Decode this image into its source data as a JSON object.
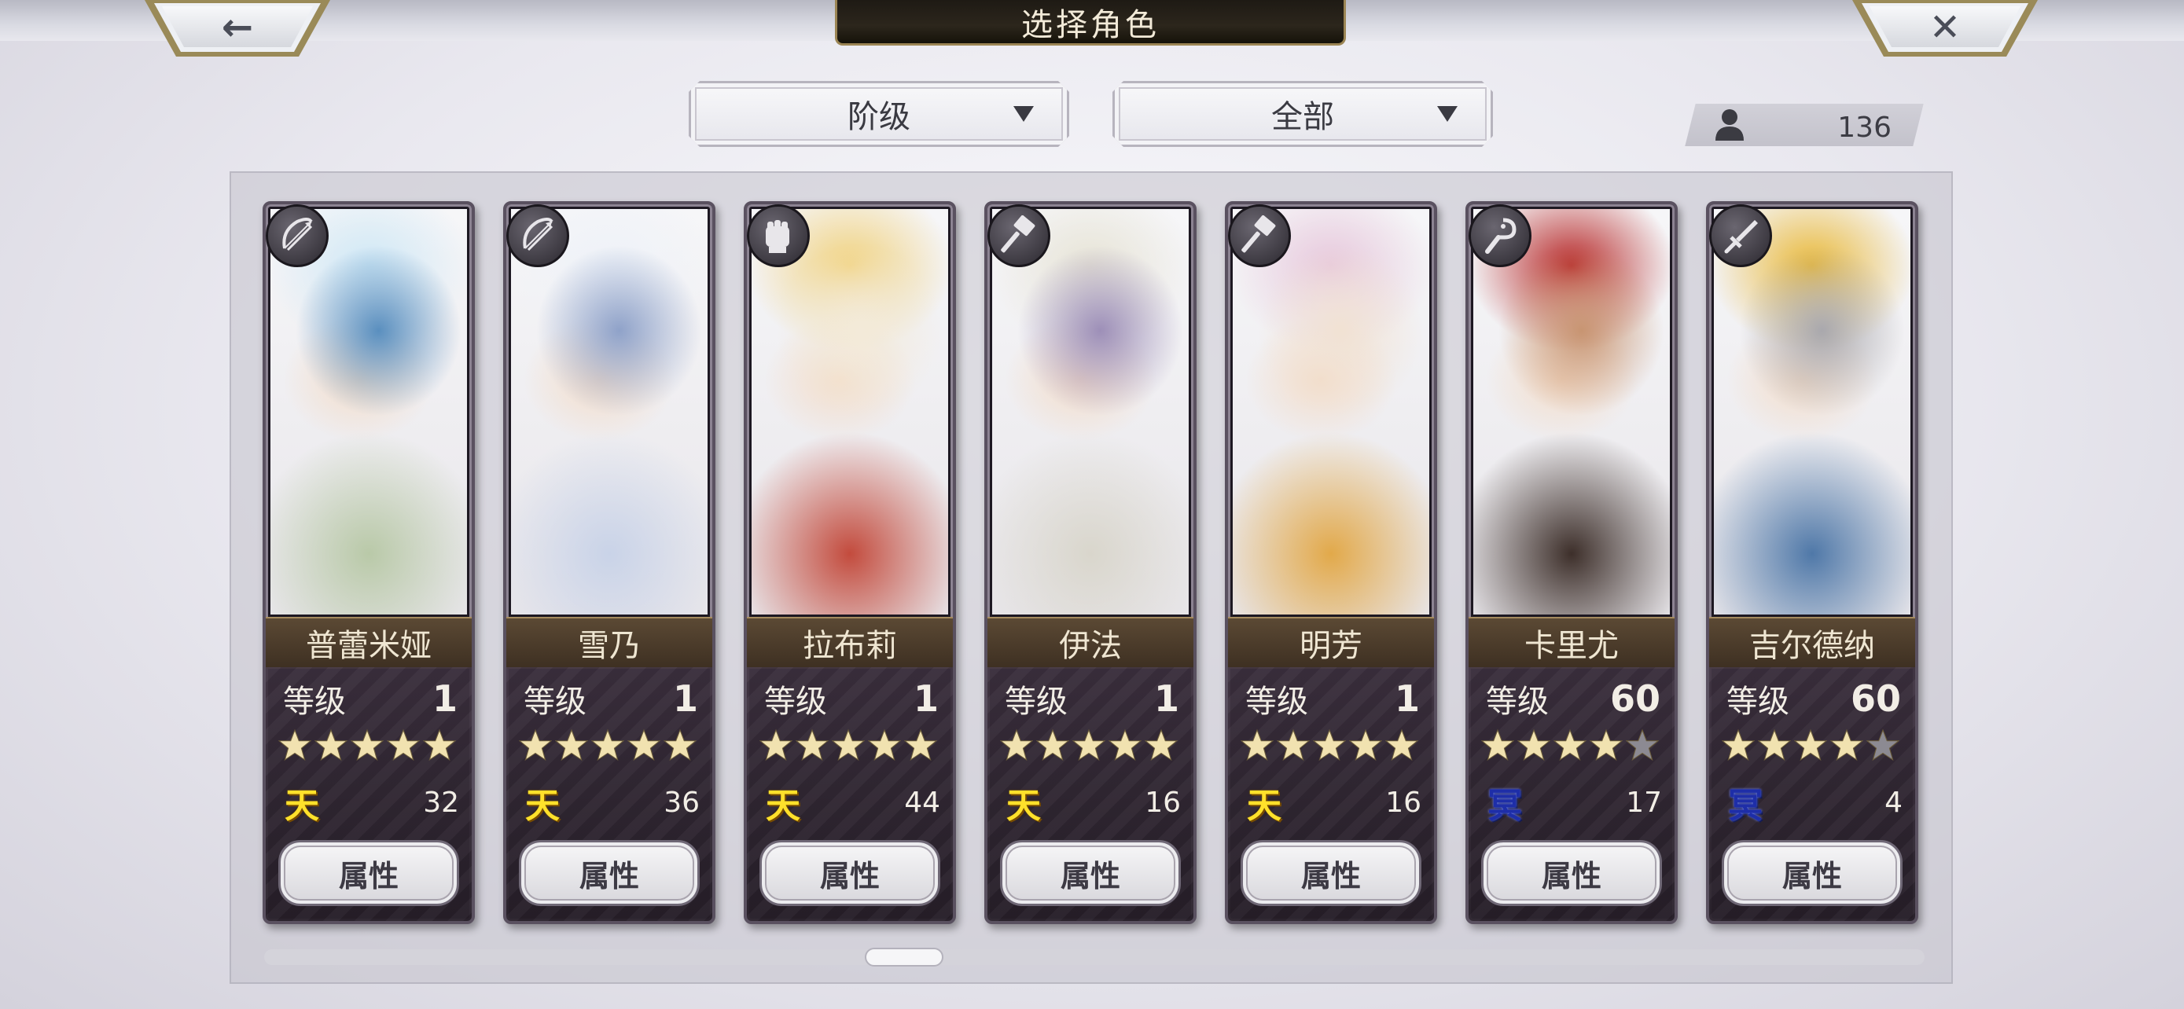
{
  "header": {
    "title": "选择角色",
    "back_icon": "left-arrow-icon",
    "close_icon": "close-icon",
    "back_glyph": "←",
    "close_glyph": "✕"
  },
  "filters": {
    "rank_label": "阶级",
    "all_label": "全部"
  },
  "roster": {
    "count": "136",
    "icon": "user-icon"
  },
  "labels": {
    "level": "等级",
    "attributes": "属性"
  },
  "characters": [
    {
      "name": "普蕾米娅",
      "class_icon": "bow-icon",
      "level": "1",
      "stars": 5,
      "type": "天",
      "type_class": "tian",
      "value": "32",
      "palette": [
        "#cfe8f6",
        "#b9c9a8",
        "#5a8fbf"
      ]
    },
    {
      "name": "雪乃",
      "class_icon": "bow-icon",
      "level": "1",
      "stars": 5,
      "type": "天",
      "type_class": "tian",
      "value": "36",
      "palette": [
        "#eef2f8",
        "#c9d3e8",
        "#8fa2c9"
      ]
    },
    {
      "name": "拉布莉",
      "class_icon": "fist-icon",
      "level": "1",
      "stars": 5,
      "type": "天",
      "type_class": "tian",
      "value": "44",
      "palette": [
        "#f1d27e",
        "#c34b3d",
        "#f3ead9"
      ]
    },
    {
      "name": "伊法",
      "class_icon": "hammer-icon",
      "level": "1",
      "stars": 5,
      "type": "天",
      "type_class": "tian",
      "value": "16",
      "palette": [
        "#e7e4d6",
        "#d9d6cc",
        "#9d8fb8"
      ]
    },
    {
      "name": "明芳",
      "class_icon": "hammer-icon",
      "level": "1",
      "stars": 5,
      "type": "天",
      "type_class": "tian",
      "value": "16",
      "palette": [
        "#e7c8dc",
        "#e2a94a",
        "#f1e2d3"
      ]
    },
    {
      "name": "卡里尤",
      "class_icon": "hook-icon",
      "level": "60",
      "stars": 4,
      "type": "冥",
      "type_class": "ming",
      "value": "17",
      "palette": [
        "#b72a2a",
        "#3d2f2a",
        "#c89572"
      ]
    },
    {
      "name": "吉尔德纳",
      "class_icon": "sword-icon",
      "level": "60",
      "stars": 4,
      "type": "冥",
      "type_class": "ming",
      "value": "4",
      "palette": [
        "#e9b93a",
        "#4f78a8",
        "#a9a8ad"
      ]
    }
  ],
  "colors": {
    "star_on": "#f1e2b0",
    "star_off": "#8c8a92",
    "tian": "#ffe12b",
    "ming": "#1e2ea8"
  }
}
